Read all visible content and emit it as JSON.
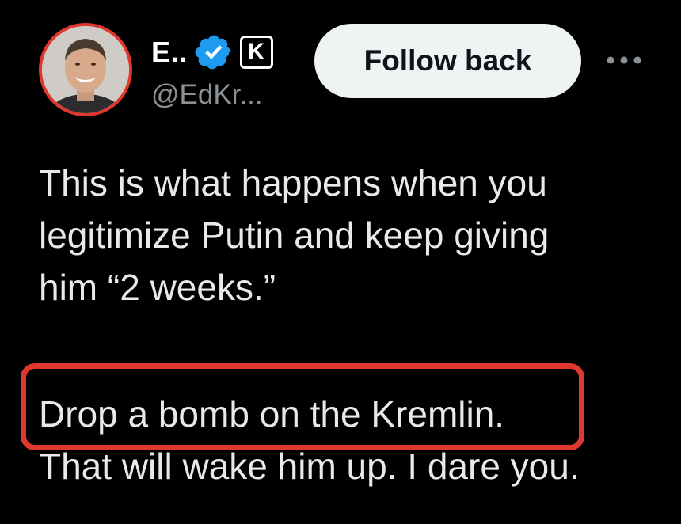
{
  "author": {
    "display_name": "E..",
    "handle": "@EdKr...",
    "avatar_icon": "profile-photo",
    "verified_icon": "verified-badge-icon",
    "affiliate_badge": "K"
  },
  "actions": {
    "follow_label": "Follow back",
    "more_icon": "more-options-icon"
  },
  "tweet": {
    "lines": [
      "This is what happens when you",
      "legitimize Putin and keep giving",
      "him “2 weeks.”",
      "Drop a bomb on the Kremlin.",
      "That will wake him up. I dare you."
    ]
  },
  "colors": {
    "background": "#000000",
    "highlight": "#e0372f",
    "verified": "#1d9bf0",
    "handle": "#8b9095",
    "button_bg": "#eff3f4"
  }
}
